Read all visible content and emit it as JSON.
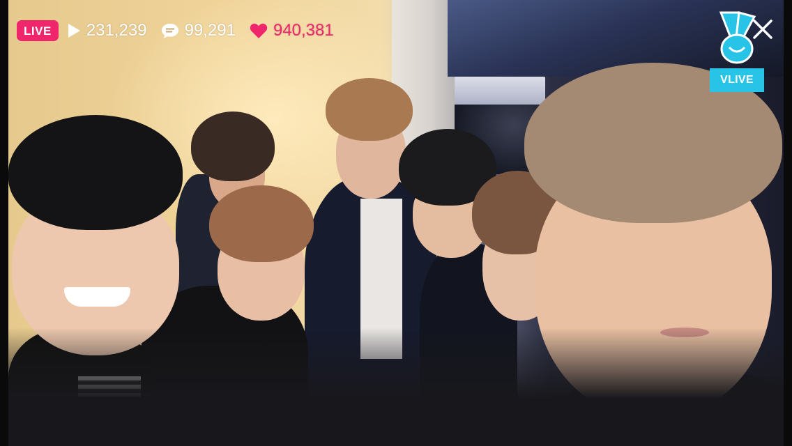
{
  "live_badge": "LIVE",
  "stats": {
    "views": "231,239",
    "comments": "99,291",
    "hearts": "940,381"
  },
  "brand": {
    "name": "VLIVE",
    "accent_color": "#27c4e8",
    "live_color": "#f0266c"
  },
  "icons": {
    "views": "play-icon",
    "comments": "chat-bubble-icon",
    "hearts": "heart-icon",
    "close": "close-icon",
    "logo": "v-hand-logo-icon"
  }
}
